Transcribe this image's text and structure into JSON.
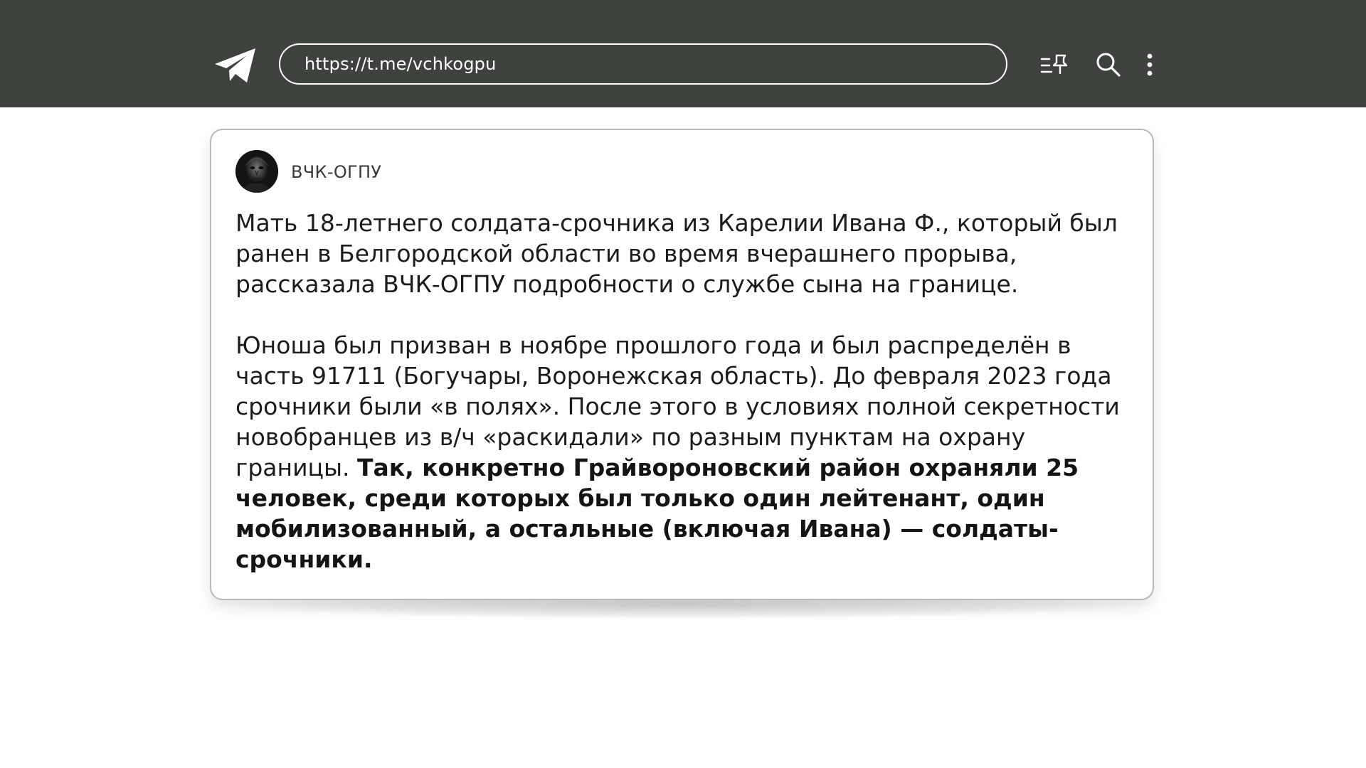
{
  "header": {
    "url": "https://t.me/vchkogpu",
    "icons": {
      "logo": "telegram-logo-icon",
      "pinned": "pinned-list-icon",
      "search": "search-icon",
      "menu": "more-vertical-icon"
    },
    "colors": {
      "bar_background": "#3e423d",
      "foreground": "#ffffff"
    }
  },
  "post": {
    "channel_name": "ВЧК-ОГПУ",
    "paragraph1": "Мать 18-летнего солдата-срочника из Карелии Ивана Ф., который был ранен в Белгородской области во время вчерашнего прорыва, рассказала ВЧК-ОГПУ подробности о службе сына на границе.",
    "paragraph2_regular": "Юноша был призван в ноябре прошлого года и был распределён в часть 91711 (Богучары, Воронежская область). До февраля 2023 года срочники были «в полях». После этого в условиях полной секретности новобранцев из в/ч «раскидали» по разным пунктам на охрану границы.",
    "paragraph2_bold": "Так, конкретно Грайвороновский район охраняли 25 человек, среди которых был только один лейтенант, один мобилизованный, а остальные (включая Ивана) — солдаты-срочники.",
    "avatar": "channel-avatar"
  }
}
